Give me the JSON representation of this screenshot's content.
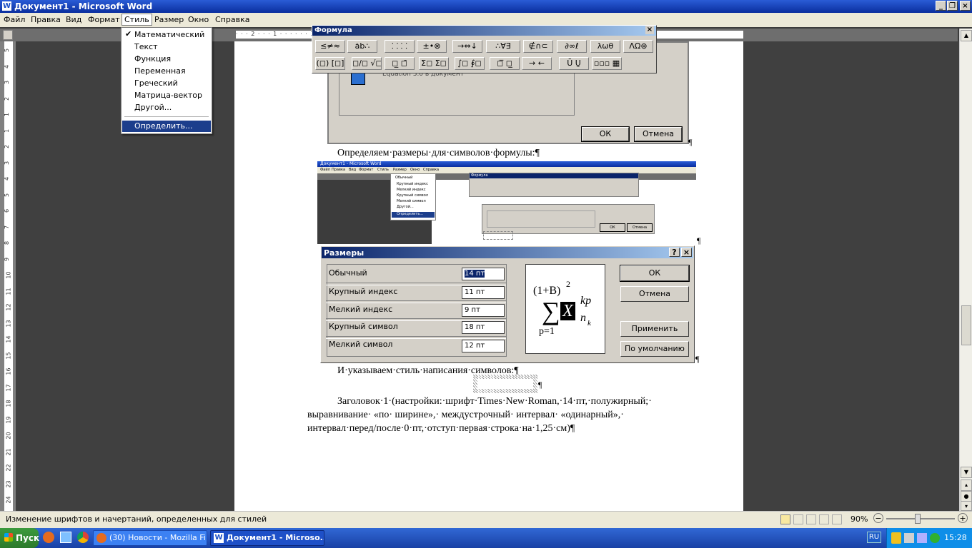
{
  "window": {
    "title": "Документ1 - Microsoft Word"
  },
  "menubar": {
    "items": [
      "Файл",
      "Правка",
      "Вид",
      "Формат",
      "Стиль",
      "Размер",
      "Окно",
      "Справка"
    ]
  },
  "ruler": {
    "text": "· · · 2 · · · 1 · · ·   · · · 15 · · · 16 · · · 17 · ·"
  },
  "vruler": {
    "labels": [
      "5",
      "4",
      "3",
      "2",
      "1",
      "1",
      "2",
      "3",
      "4",
      "5",
      "6",
      "7",
      "8",
      "9",
      "10",
      "11",
      "12",
      "13",
      "14",
      "15",
      "16",
      "17",
      "18",
      "19",
      "20",
      "21",
      "22",
      "23",
      "24"
    ]
  },
  "style_menu": {
    "items": [
      "Математический",
      "Текст",
      "Функция",
      "Переменная",
      "Греческий",
      "Матрица-вектор",
      "Другой..."
    ],
    "checked_index": 0,
    "define_label": "Определить..."
  },
  "formula_toolbar": {
    "title": "Формула",
    "close": "×",
    "row1": [
      "≤≠≈",
      "ȧb∴",
      "⸬ ⸬",
      "±•⊗",
      "→⇔↓",
      "∴∀∃",
      "∉∩⊂",
      "∂∞ℓ",
      "λωθ",
      "ΛΩ⊛"
    ],
    "row2": [
      "(◻) [◻]",
      "◻/◻ √◻",
      "◻̲ ◻̄",
      "Σ◻ Σ◻",
      "∫◻ ∮◻",
      "◻̅ ◻̲",
      "→ ←",
      "Ū Ṳ",
      "▫▫▫ ▦"
    ]
  },
  "old_dialog": {
    "partial_text": "Equation 3.0 в документ",
    "ok": "ОК",
    "cancel": "Отмена"
  },
  "doc": {
    "p1": "Определяем·размеры·для·символов·формулы:¶",
    "p2": "И·указываем·стиль·написания·символов:¶",
    "p3_line1": "Заголовок·1·(настройки:·шрифт·Times·New·Roman,·14·пт,·полужирный;·",
    "p3_line2": "выравнивание· «по· ширине»,· междустрочный· интервал· «одинарный»,·",
    "p3_line3": "интервал·перед/после·0·пт,·отступ·первая·строка·на·1,25·см)¶",
    "pilcrow": "¶"
  },
  "thumb": {
    "title": "Документ1 - Microsoft Word",
    "menu": [
      "Файл",
      "Правка",
      "Вид",
      "Формат",
      "Стиль",
      "Размер",
      "Окно",
      "Справка"
    ],
    "size_menu": [
      "Обычный",
      "Крупный индекс",
      "Мелкий индекс",
      "Крупный символ",
      "Мелкий символ",
      "Другой...",
      "Определить..."
    ],
    "formula_title": "Формула",
    "ok": "ОК",
    "cancel": "Отмена"
  },
  "sizes_dialog": {
    "title": "Размеры",
    "help": "?",
    "close": "×",
    "rows": [
      {
        "label": "Обычный",
        "value": "14 пт"
      },
      {
        "label": "Крупный индекс",
        "value": "11 пт"
      },
      {
        "label": "Мелкий индекс",
        "value": "9 пт"
      },
      {
        "label": "Крупный символ",
        "value": "18 пт"
      },
      {
        "label": "Мелкий символ",
        "value": "12 пт"
      }
    ],
    "preview": {
      "paren": "(1+B)",
      "sup2": "2",
      "sigma": "∑",
      "x": "X",
      "kp": "kp",
      "n": "n",
      "k": "k",
      "p1": "p=1"
    },
    "ok": "ОК",
    "cancel": "Отмена",
    "apply": "Применить",
    "default": "По умолчанию"
  },
  "statusbar": {
    "text": "Изменение шрифтов и начертаний, определенных для стилей",
    "zoom": "90%"
  },
  "taskbar": {
    "start": "Пуск",
    "tasks": [
      "(30) Новости - Mozilla Fi...",
      "Документ1 - Microso..."
    ],
    "lang": "RU",
    "clock": "15:28"
  },
  "colors": {
    "accent": "#0a246a",
    "xp_blue": "#1941a5",
    "selection": "#1c3e8c"
  }
}
